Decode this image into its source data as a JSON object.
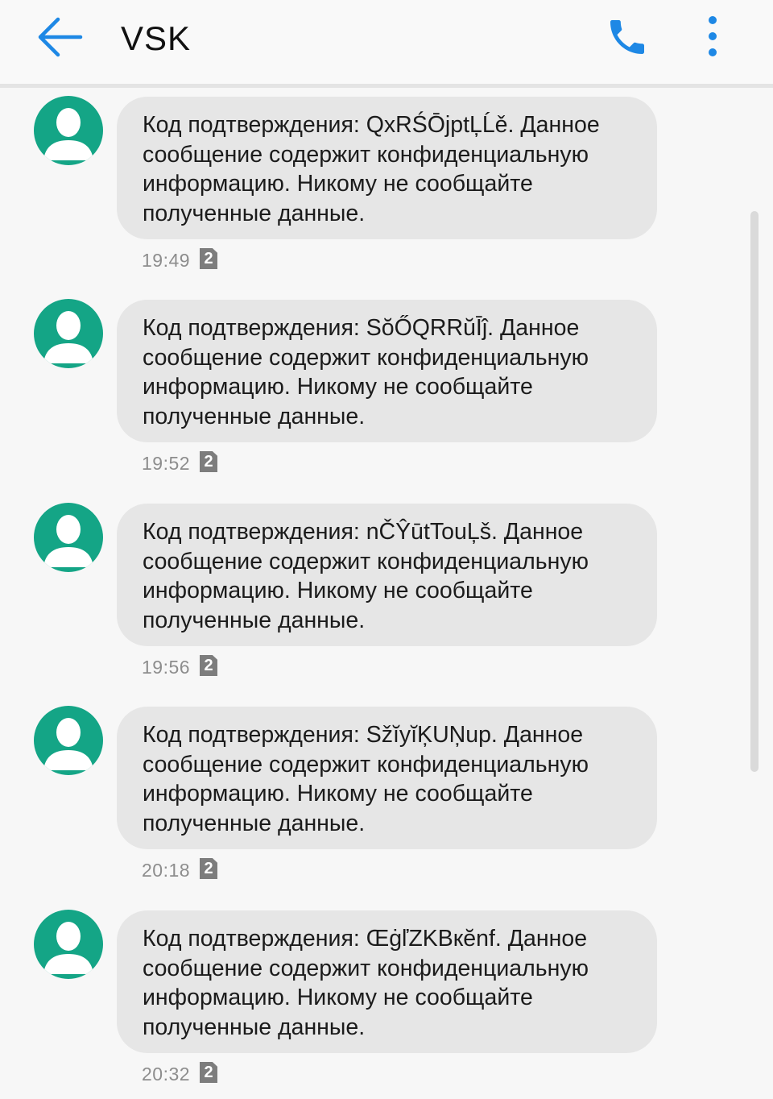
{
  "header": {
    "title": "VSK",
    "back_icon": "arrow-left-icon",
    "call_icon": "phone-icon",
    "menu_icon": "more-vertical-icon",
    "accent_color": "#1e88e5"
  },
  "avatar": {
    "icon": "person-icon",
    "color": "#14a586"
  },
  "sim_badge_color": "#7d7d7d",
  "messages": [
    {
      "lines": [
        "Код подтверждения: QxRŚŌjptĻĹě. Данное",
        "сообщение содержит конфиденциальную",
        "информацию. Никому не сообщайте",
        "полученные данные."
      ],
      "time": "19:49",
      "sim": "2"
    },
    {
      "lines": [
        "Код подтверждения: SŏŐQRRŭĪĵ. Данное",
        "сообщение содержит конфиденциальную",
        "информацию. Никому не сообщайте",
        "полученные данные."
      ],
      "time": "19:52",
      "sim": "2"
    },
    {
      "lines": [
        "Код подтверждения: nČŶūtTouĻš. Данное",
        "сообщение содержит конфиденциальную",
        "информацию. Никому не сообщайте",
        "полученные данные."
      ],
      "time": "19:56",
      "sim": "2"
    },
    {
      "lines": [
        "Код подтверждения: SžĭyĭĶUŅup. Данное",
        "сообщение содержит конфиденциальную",
        "информацию. Никому не сообщайте",
        "полученные данные."
      ],
      "time": "20:18",
      "sim": "2"
    },
    {
      "lines": [
        "Код подтверждения: ŒġľZKBкĕnf. Данное",
        "сообщение содержит конфиденциальную",
        "информацию. Никому не сообщайте",
        "полученные данные."
      ],
      "time": "20:32",
      "sim": "2"
    }
  ]
}
